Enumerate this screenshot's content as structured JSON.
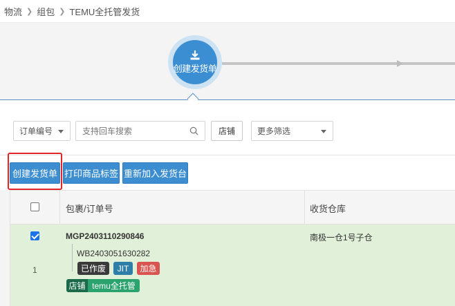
{
  "breadcrumb": {
    "items": [
      "物流",
      "组包",
      "TEMU全托管发货"
    ]
  },
  "steps": {
    "current_label": "创建发货单",
    "icon": "download-icon"
  },
  "filters": {
    "order_type_label": "订单编号",
    "search_placeholder": "支持回车搜索",
    "shop_button": "店铺",
    "more_filters_label": "更多筛选"
  },
  "toolbar": {
    "create_label": "创建发货单",
    "print_label": "打印商品标签",
    "rejoin_label": "重新加入发货台"
  },
  "table": {
    "columns": {
      "package": "包裹/订单号",
      "warehouse": "收货仓库"
    },
    "rows": [
      {
        "index": "1",
        "package_no": "MGP2403110290846",
        "order_no": "WB2403051630282",
        "tags": {
          "voided": "已作废",
          "jit": "JIT",
          "urgent": "加急"
        },
        "shop_label": "店铺",
        "shop_name": "temu全托管",
        "warehouse": "南极一仓1号子仓"
      }
    ]
  },
  "colors": {
    "primary": "#3d8ed0",
    "highlight": "#e2242b",
    "row_selected": "#e1f0d8",
    "tag_voided": "#3a3a3a",
    "tag_jit": "#2e7fa7",
    "tag_urgent": "#d9544f",
    "tag_shop": "#1b6b4a",
    "tag_shop_name": "#2aa36f"
  }
}
